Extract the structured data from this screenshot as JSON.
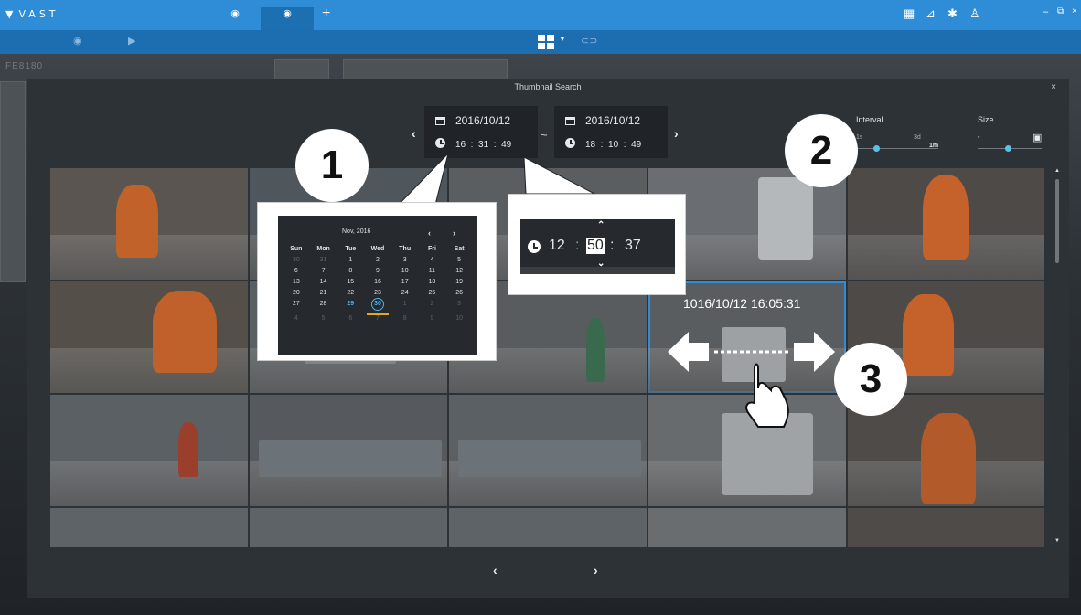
{
  "app": {
    "name": "VAST"
  },
  "dialog": {
    "title": "Thumbnail Search",
    "close": "×"
  },
  "range": {
    "start": {
      "date": "2016/10/12",
      "hh": "16",
      "mm": "31",
      "ss": "49"
    },
    "separator": "~",
    "end": {
      "date": "2016/10/12",
      "hh": "18",
      "mm": "10",
      "ss": "49"
    }
  },
  "interval": {
    "label": "Interval",
    "min": "1s",
    "max": "3d",
    "value": "1m"
  },
  "size": {
    "label": "Size"
  },
  "selected_thumb": {
    "timestamp": "1016/10/12 16:05:31"
  },
  "calendar": {
    "month": "Nov, 2016",
    "weekdays": [
      "Sun",
      "Mon",
      "Tue",
      "Wed",
      "Thu",
      "Fri",
      "Sat"
    ],
    "days": [
      "30",
      "31",
      "1",
      "2",
      "3",
      "4",
      "5",
      "6",
      "7",
      "8",
      "9",
      "10",
      "11",
      "12",
      "13",
      "14",
      "15",
      "16",
      "17",
      "18",
      "19",
      "20",
      "21",
      "22",
      "23",
      "24",
      "25",
      "26",
      "27",
      "28",
      "29",
      "30",
      "1",
      "2",
      "3",
      "4",
      "5",
      "6",
      "7",
      "8",
      "9",
      "10"
    ]
  },
  "time_editor": {
    "hh": "12",
    "mm": "50",
    "ss": "37"
  },
  "callouts": [
    "1",
    "2",
    "3"
  ],
  "bg": {
    "camera_label": "FE8180"
  },
  "colors": {
    "accent": "#2e8dd6",
    "subbar": "#1d6eb0",
    "calendar_today": "#49b3ec"
  }
}
